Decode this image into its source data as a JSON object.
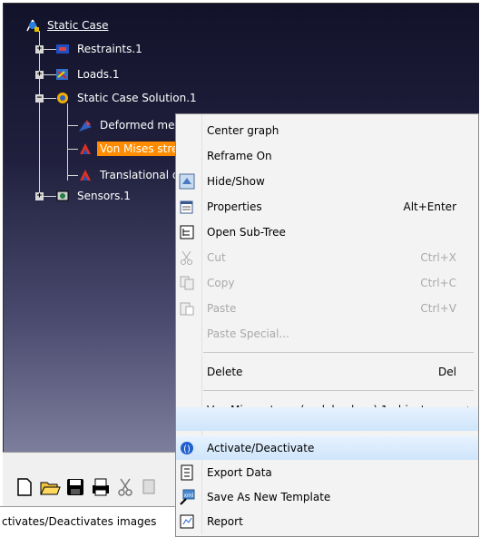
{
  "tree": {
    "root_label": "Static Case",
    "restraints_label": "Restraints.1",
    "loads_label": "Loads.1",
    "solution_label": "Static Case Solution.1",
    "deformed_label": "Deformed mesh",
    "vonmises_label": "Von Mises stre",
    "translational_label": "Translational d",
    "sensors_label": "Sensors.1"
  },
  "context_menu": {
    "center_graph": "Center graph",
    "reframe_on": "Reframe On",
    "hide_show": "Hide/Show",
    "properties": "Properties",
    "properties_shortcut": "Alt+Enter",
    "open_subtree": "Open Sub-Tree",
    "cut": "Cut",
    "cut_shortcut": "Ctrl+X",
    "copy": "Copy",
    "copy_shortcut": "Ctrl+C",
    "paste": "Paste",
    "paste_shortcut": "Ctrl+V",
    "paste_special": "Paste Special...",
    "delete": "Delete",
    "delete_shortcut": "Del",
    "object_submenu": "Von Mises stress (nodal values).1 object",
    "activate": "Activate/Deactivate",
    "export_data": "Export Data",
    "save_template": "Save As New Template",
    "report": "Report"
  },
  "status_bar": {
    "text": "ctivates/Deactivates images"
  },
  "colors": {
    "selection": "#ff8c00",
    "menu_highlight": "#cfe5fb",
    "tree_bg_top": "#12122a"
  }
}
